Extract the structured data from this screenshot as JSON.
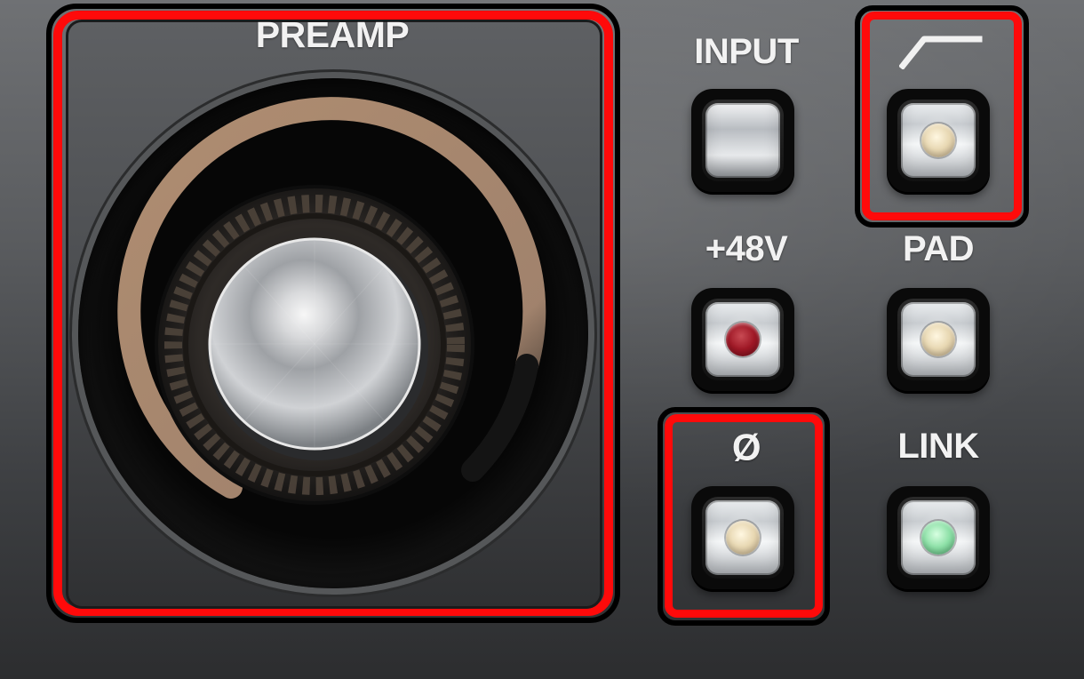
{
  "panel": {
    "preamp_label": "PREAMP",
    "controls": {
      "input": {
        "label": "INPUT"
      },
      "high_pass": {
        "icon": "high-pass-icon"
      },
      "phantom": {
        "label": "+48V"
      },
      "pad": {
        "label": "PAD"
      },
      "phase": {
        "label": "Ø"
      },
      "link": {
        "label": "LINK"
      }
    },
    "colors": {
      "highlight": "#ff0a0a",
      "arc": "#b38f73",
      "panel_dark": "#2c2d2f",
      "phantom_led": "#9f1826",
      "cream_led": "#e8d8b3",
      "link_led": "#8de0a7"
    }
  }
}
